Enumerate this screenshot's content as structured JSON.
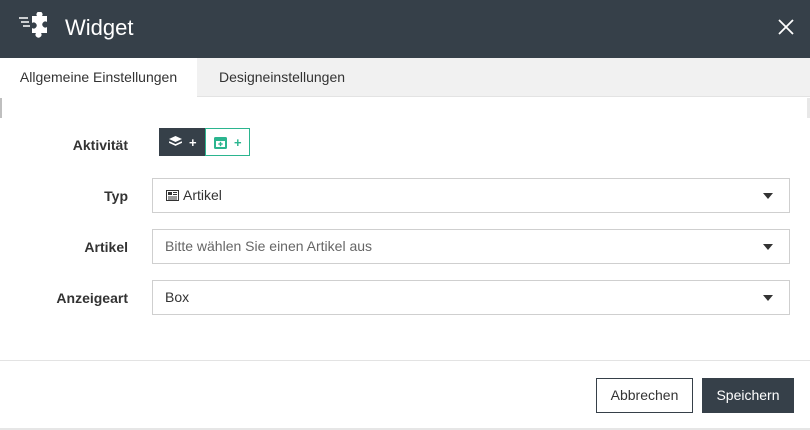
{
  "dialog": {
    "title": "Widget",
    "icons": {
      "logo": "puzzle-icon",
      "close": "close-icon"
    }
  },
  "tabs": [
    {
      "label": "Allgemeine Einstellungen",
      "active": true
    },
    {
      "label": "Designeinstellungen",
      "active": false
    }
  ],
  "form": {
    "activity": {
      "label": "Aktivität",
      "buttons": [
        {
          "icon": "layers-icon",
          "plus": "+"
        },
        {
          "icon": "calendar-plus-icon",
          "plus": "+"
        }
      ]
    },
    "type": {
      "label": "Typ",
      "value": "Artikel",
      "icon": "newspaper-icon"
    },
    "article": {
      "label": "Artikel",
      "placeholder": "Bitte wählen Sie einen Artikel aus"
    },
    "display": {
      "label": "Anzeigeart",
      "value": "Box"
    }
  },
  "footer": {
    "cancel_label": "Abbrechen",
    "save_label": "Speichern"
  },
  "colors": {
    "header_bg": "#364049",
    "accent_green": "#2bb58f",
    "tab_bg": "#f1f1f1"
  }
}
